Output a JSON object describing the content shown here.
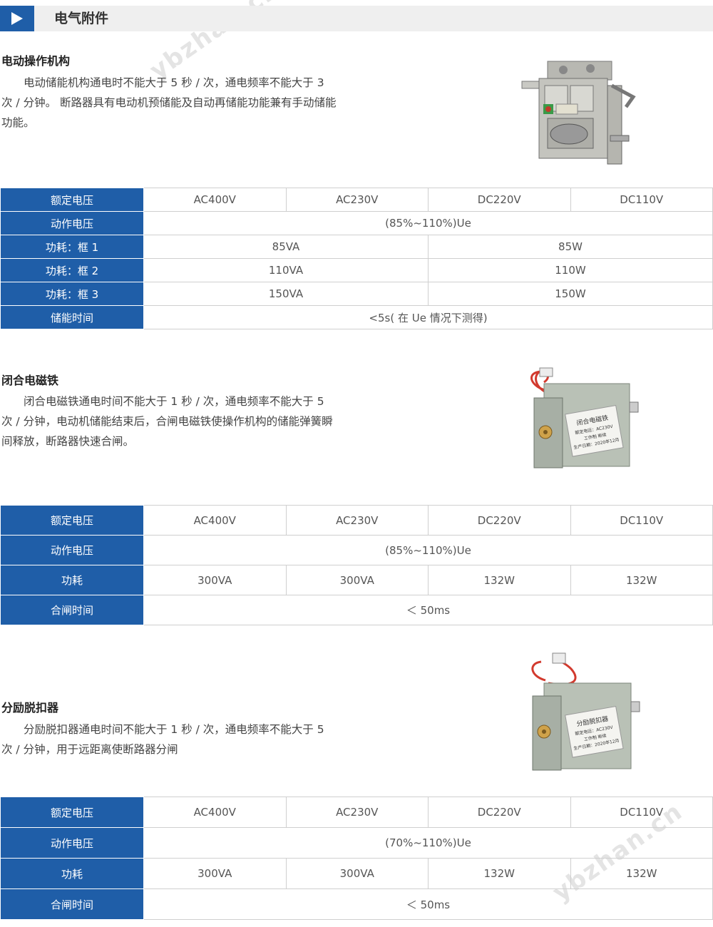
{
  "header": {
    "title": "电气附件"
  },
  "watermark": "ybzhan.cn",
  "sections": [
    {
      "title": "电动操作机构",
      "description": "电动储能机构通电时不能大于 5 秒 / 次，通电频率不能大于 3 次 / 分钟。 断路器具有电动机预储能及自动再储能功能兼有手动储能功能。",
      "table": {
        "rated_label": "额定电压",
        "voltages": [
          "AC400V",
          "AC230V",
          "DC220V",
          "DC110V"
        ],
        "op_label": "动作电压",
        "op_value": "(85%~110%)Ue",
        "power_rows": [
          {
            "label": "功耗：框 1",
            "ac": "85VA",
            "dc": "85W"
          },
          {
            "label": "功耗：框 2",
            "ac": "110VA",
            "dc": "110W"
          },
          {
            "label": "功耗：框 3",
            "ac": "150VA",
            "dc": "150W"
          }
        ],
        "time_label": "储能时间",
        "time_value": "<5s( 在 Ue 情况下测得)"
      }
    },
    {
      "title": "闭合电磁铁",
      "description": "闭合电磁铁通电时间不能大于 1 秒 / 次，通电频率不能大于 5 次 / 分钟，电动机储能结束后，合闸电磁铁使操作机构的储能弹簧瞬间释放，断路器快速合闸。",
      "label_plate": [
        "闭合电磁铁",
        "额定电压：AC230V",
        "工作制  断续",
        "生产日期：2020年12月"
      ],
      "table": {
        "rated_label": "额定电压",
        "voltages": [
          "AC400V",
          "AC230V",
          "DC220V",
          "DC110V"
        ],
        "op_label": "动作电压",
        "op_value": "(85%~110%)Ue",
        "power_label": "功耗",
        "power_values": [
          "300VA",
          "300VA",
          "132W",
          "132W"
        ],
        "time_label": "合闸时间",
        "time_value": "＜ 50ms"
      }
    },
    {
      "title": "分励脱扣器",
      "description": "分励脱扣器通电时间不能大于 1 秒 / 次，通电频率不能大于 5 次 / 分钟，用于远距离使断路器分闸",
      "label_plate": [
        "分励脱扣器",
        "额定电压：AC230V",
        "工作制  断续",
        "生产日期：2020年12月"
      ],
      "table": {
        "rated_label": "额定电压",
        "voltages": [
          "AC400V",
          "AC230V",
          "DC220V",
          "DC110V"
        ],
        "op_label": "动作电压",
        "op_value": "(70%~110%)Ue",
        "power_label": "功耗",
        "power_values": [
          "300VA",
          "300VA",
          "132W",
          "132W"
        ],
        "time_label": "合闸时间",
        "time_value": "＜ 50ms"
      }
    }
  ],
  "colors": {
    "accent": "#1f5ea8",
    "header_bg": "#efefef",
    "border": "#cfcfcf"
  }
}
